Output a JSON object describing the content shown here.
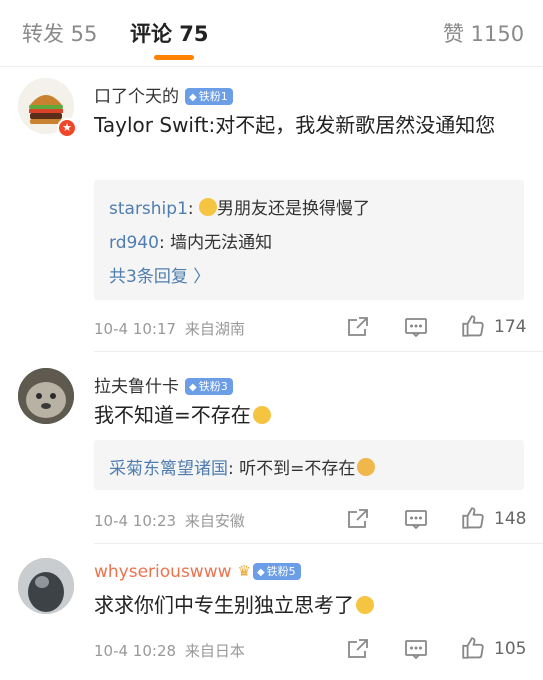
{
  "tabs": [
    {
      "label": "转发 55"
    },
    {
      "label": "评论 75"
    },
    {
      "label": "赞 1150"
    }
  ],
  "comments": [
    {
      "username": "口了个天的",
      "fan_badge": "铁粉1",
      "text": "Taylor Swift:对不起，我发新歌居然没通知您",
      "replies": [
        {
          "user": "starship1",
          "sep": ": ",
          "text": "男朋友还是换得慢了"
        },
        {
          "user": "rd940",
          "sep": ": ",
          "text": "墙内无法通知"
        }
      ],
      "more_replies": "共3条回复 〉",
      "time": "10-4 10:17",
      "location": "来自湖南",
      "likes": "174"
    },
    {
      "username": "拉夫鲁什卡",
      "fan_badge": "铁粉3",
      "text": "我不知道=不存在",
      "replies": [
        {
          "user": "采菊东篱望诸国",
          "sep": ": ",
          "text": "听不到=不存在"
        }
      ],
      "time": "10-4 10:23",
      "location": "来自安徽",
      "likes": "148"
    },
    {
      "username": "whyseriouswww",
      "fan_badge": "铁粉5",
      "text": "求求你们中专生别独立思考了",
      "time": "10-4 10:28",
      "location": "来自日本",
      "likes": "105"
    }
  ],
  "colors": {
    "accent": "#ff8200",
    "link_blue": "#507daf",
    "fan_badge": "#6b9ee6",
    "orange_name": "#eb7350"
  }
}
